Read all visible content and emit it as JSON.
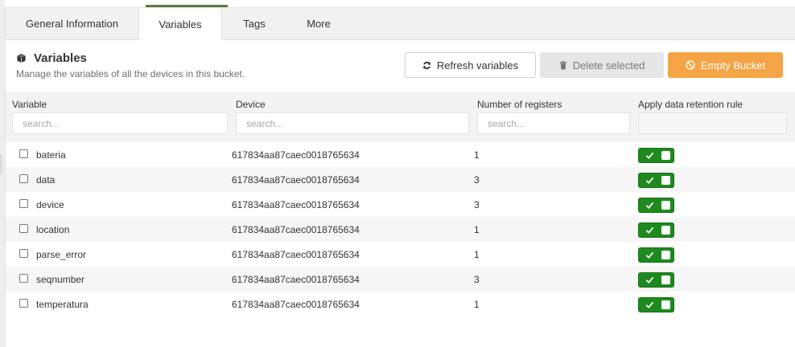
{
  "tabs": [
    {
      "label": "General Information",
      "active": false
    },
    {
      "label": "Variables",
      "active": true
    },
    {
      "label": "Tags",
      "active": false
    },
    {
      "label": "More",
      "active": false
    }
  ],
  "section": {
    "icon": "cube-icon",
    "title": "Variables",
    "subtitle": "Manage the variables of all the devices in this bucket."
  },
  "actions": {
    "refresh_label": "Refresh variables",
    "delete_label": "Delete selected",
    "empty_label": "Empty Bucket"
  },
  "table": {
    "columns": {
      "variable": "Variable",
      "device": "Device",
      "registers": "Number of registers",
      "retention": "Apply data retention rule"
    },
    "filters": {
      "variable_placeholder": "search...",
      "device_placeholder": "search...",
      "registers_placeholder": "search..."
    },
    "rows": [
      {
        "variable": "bateria",
        "device": "617834aa87caec0018765634",
        "registers": "1",
        "retention": true
      },
      {
        "variable": "data",
        "device": "617834aa87caec0018765634",
        "registers": "3",
        "retention": true
      },
      {
        "variable": "device",
        "device": "617834aa87caec0018765634",
        "registers": "3",
        "retention": true
      },
      {
        "variable": "location",
        "device": "617834aa87caec0018765634",
        "registers": "1",
        "retention": true
      },
      {
        "variable": "parse_error",
        "device": "617834aa87caec0018765634",
        "registers": "1",
        "retention": true
      },
      {
        "variable": "seqnumber",
        "device": "617834aa87caec0018765634",
        "registers": "3",
        "retention": true
      },
      {
        "variable": "temperatura",
        "device": "617834aa87caec0018765634",
        "registers": "1",
        "retention": true
      }
    ]
  },
  "colors": {
    "accent_orange": "#f5a445",
    "toggle_green": "#1e8a1e",
    "tab_underline": "#5a7a3a"
  }
}
